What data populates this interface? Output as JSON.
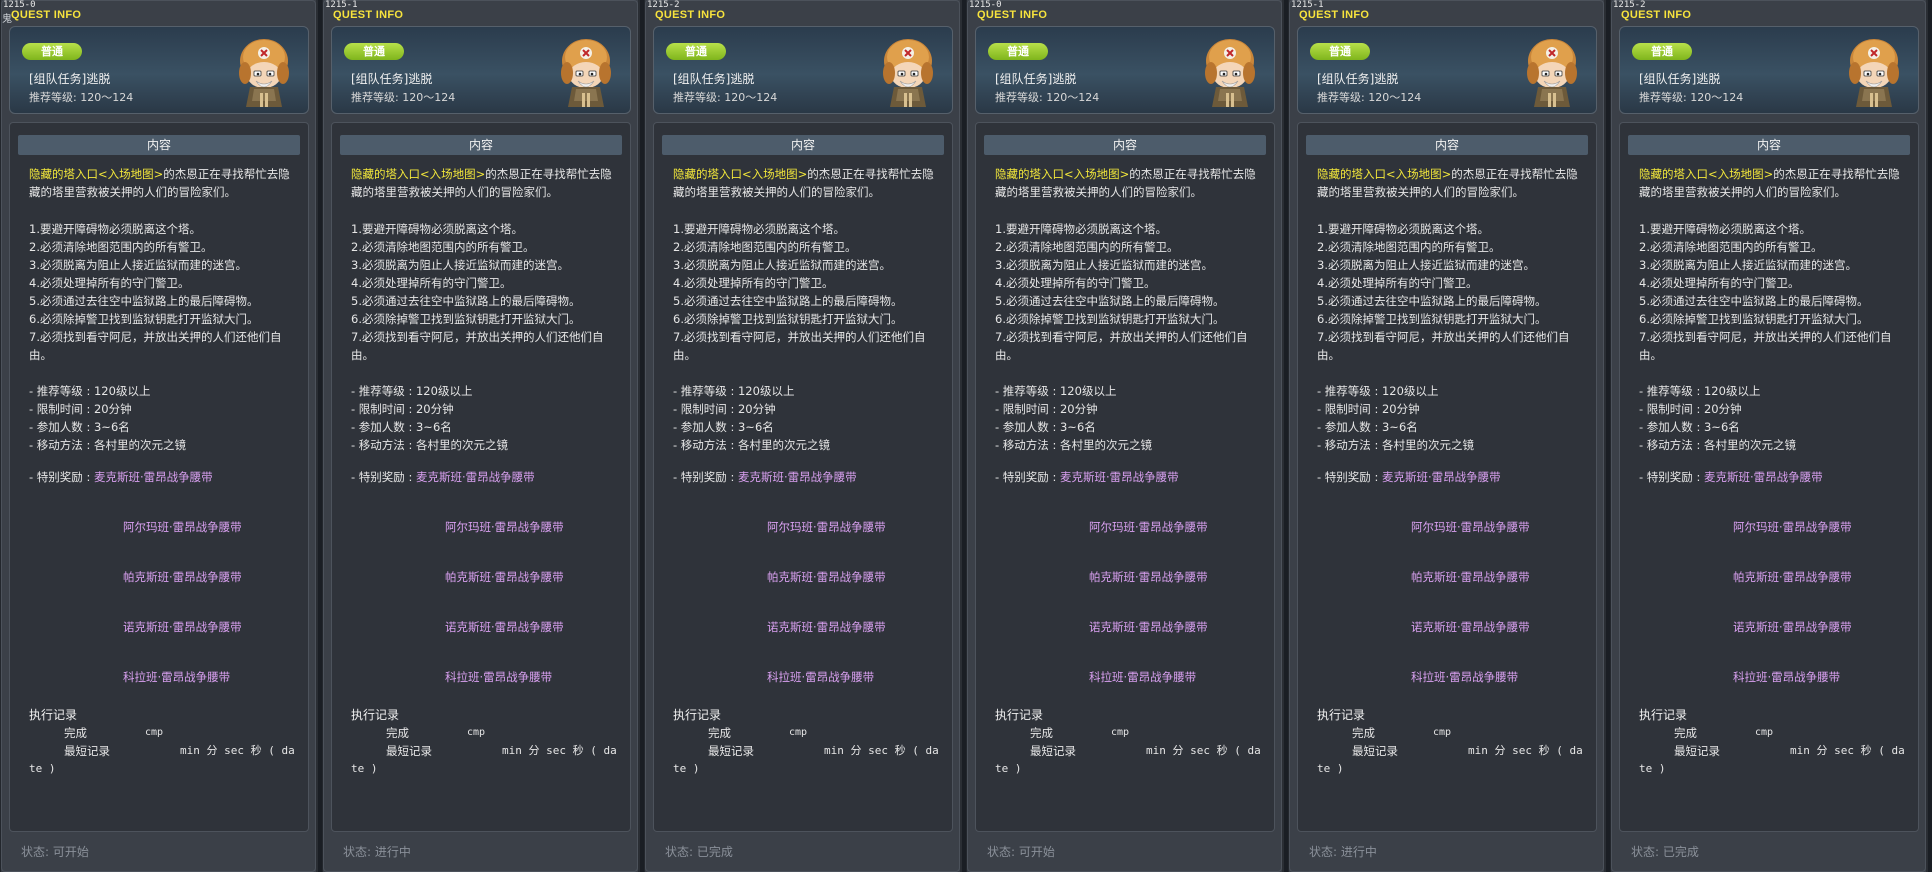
{
  "panels": [
    {
      "id": "1215-0",
      "status": "状态:  可开始"
    },
    {
      "id": "1215-1",
      "status": "状态:  进行中"
    },
    {
      "id": "1215-2",
      "status": "状态:  已完成"
    },
    {
      "id": "1215-0",
      "status": "状态:  可开始"
    },
    {
      "id": "1215-1",
      "status": "状态:  进行中"
    },
    {
      "id": "1215-2",
      "status": "状态:  已完成"
    }
  ],
  "window": {
    "corner_glyph": "鬼"
  },
  "quest": {
    "header_label": "QUEST INFO",
    "badge": "普通",
    "title": "[组队任务]逃脱",
    "level": "推荐等级:  120～124",
    "content_header": "内容",
    "desc_highlight": "隐藏的塔入口<入场地图>",
    "desc_rest": "的杰恩正在寻找帮忙去隐藏的塔里营救被关押的人们的冒险家们。",
    "steps": [
      "1.要避开障碍物必须脱离这个塔。",
      "2.必须清除地图范围内的所有警卫。",
      "3.必须脱离为阻止人接近监狱而建的迷宫。",
      "4.必须处理掉所有的守门警卫。",
      "5.必须通过去往空中监狱路上的最后障碍物。",
      "6.必须除掉警卫找到监狱钥匙打开监狱大门。",
      "7.必须找到看守阿尼，并放出关押的人们还他们自由。"
    ],
    "info": [
      "- 推荐等级 : 120级以上",
      "- 限制时间 : 20分钟",
      "- 参加人数 : 3~6名",
      "- 移动方法 : 各村里的次元之镜"
    ],
    "reward_label": "- 特别奖励 :",
    "rewards": [
      "麦克斯班·雷昂战争腰带",
      "阿尔玛班·雷昂战争腰带",
      "帕克斯班·雷昂战争腰带",
      "诺克斯班·雷昂战争腰带",
      "科拉班·雷昂战争腰带"
    ],
    "record_title": "执行记录",
    "record_done_label": "完成",
    "record_done_value": "cmp",
    "record_best_label": "最短记录",
    "record_best_value": "min 分 sec 秒 ( da",
    "record_best_value2": "te )"
  }
}
